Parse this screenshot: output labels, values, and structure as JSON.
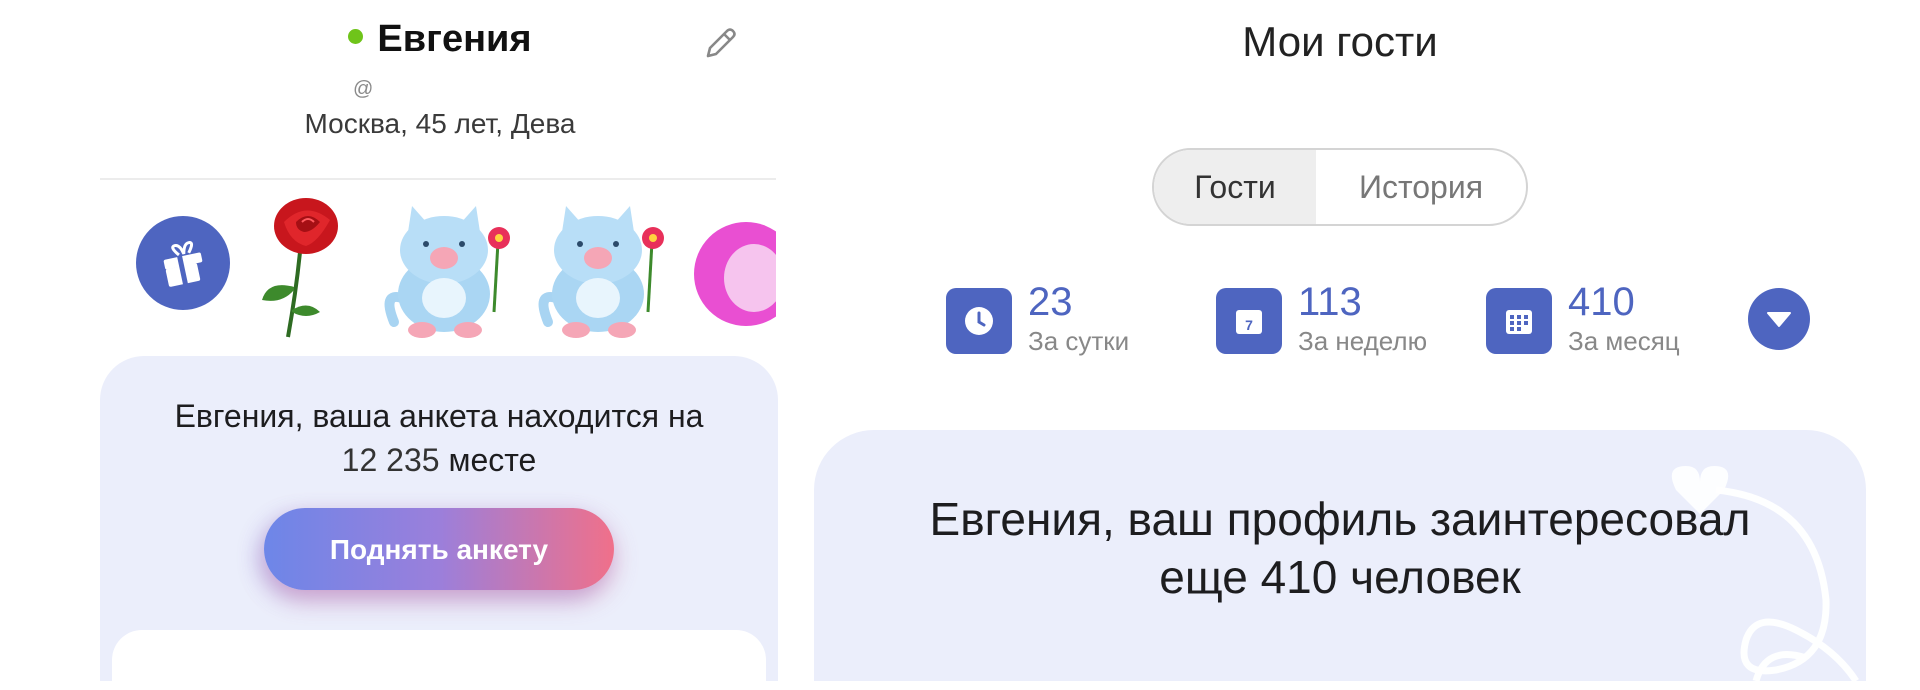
{
  "profile": {
    "name": "Евгения",
    "handle": "@",
    "location": "Москва, 45 лет, Дева"
  },
  "gifts": [
    "rose",
    "blue-cat-with-flower",
    "blue-cat-with-flower",
    "pink-plush"
  ],
  "rank_card": {
    "line1": "Евгения, ваша анкета находится на",
    "position": "12 235",
    "suffix": "месте",
    "boost_button": "Поднять анкету"
  },
  "guests": {
    "title": "Мои гости",
    "tabs": [
      {
        "label": "Гости",
        "selected": true
      },
      {
        "label": "История",
        "selected": false
      }
    ],
    "stats": [
      {
        "value": "23",
        "label": "За сутки",
        "icon": "clock-icon"
      },
      {
        "value": "113",
        "label": "За неделю",
        "icon": "calendar-7-icon"
      },
      {
        "value": "410",
        "label": "За месяц",
        "icon": "calendar-grid-icon"
      }
    ],
    "interest_line1": "Евгения, ваш профиль заинтересовал",
    "interest_line2": "еще 410 человек"
  },
  "colors": {
    "accent": "#4e65c0",
    "online": "#6fc41a",
    "card_bg": "#ebeefb",
    "button_gradient_start": "#6d86e8",
    "button_gradient_end": "#f0708a"
  }
}
